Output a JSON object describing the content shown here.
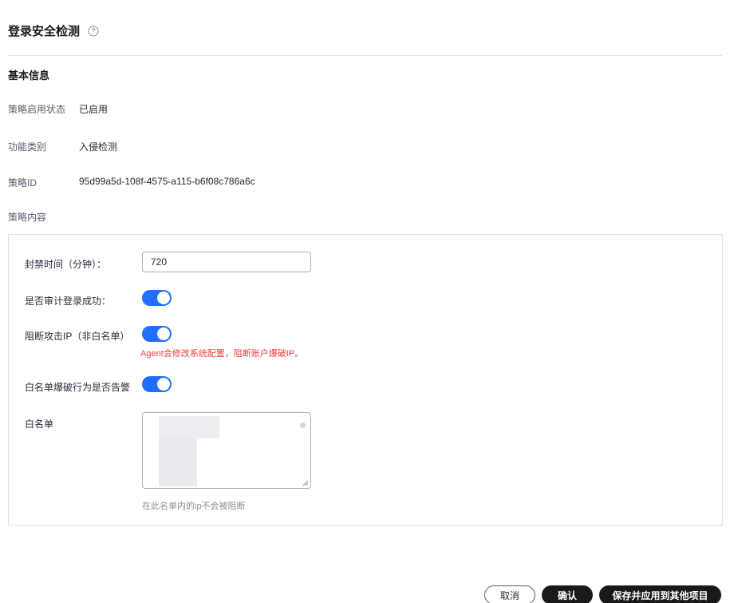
{
  "header": {
    "title": "登录安全检测",
    "help_icon": "question-circle-icon"
  },
  "basic_info": {
    "section_title": "基本信息",
    "status_label": "策略启用状态",
    "status_value": "已启用",
    "category_label": "功能类别",
    "category_value": "入侵检测",
    "policy_id_label": "策略ID",
    "policy_id_value": "95d99a5d-108f-4575-a115-b6f08c786a6c",
    "content_label": "策略内容"
  },
  "policy": {
    "ban_time_label": "封禁时间（分钟）：",
    "ban_time_value": "720",
    "audit_login_label": "是否审计登录成功：",
    "audit_login_enabled": true,
    "block_ip_label": "阻断攻击IP（非白名单）",
    "block_ip_enabled": true,
    "block_ip_warning": "Agent会修改系统配置，阻断账户爆破IP。",
    "whitelist_alert_label": "白名单爆破行为是否告警",
    "whitelist_alert_enabled": true,
    "whitelist_label": "白名单",
    "whitelist_hint": "在此名单内的ip不会被阻断"
  },
  "footer": {
    "cancel_label": "取消",
    "confirm_label": "确认",
    "save_apply_label": "保存并应用到其他项目"
  },
  "colors": {
    "toggle_on": "#1e6fff",
    "warning": "#f23d3d",
    "primary_button": "#191919"
  }
}
